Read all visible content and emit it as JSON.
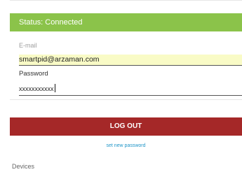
{
  "status": {
    "text": "Status: Connected",
    "color": "#8bc34a"
  },
  "login": {
    "email_label": "E-mail",
    "email_value": "smartpid@arzaman.com",
    "password_label": "Password",
    "password_value": "xxxxxxxxxxx"
  },
  "actions": {
    "logout_label": "LOG OUT",
    "logout_color": "#a52828",
    "set_password_label": "set new password"
  },
  "devices": {
    "heading": "Devices"
  }
}
